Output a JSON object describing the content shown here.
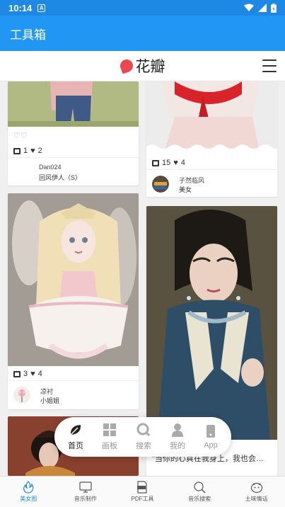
{
  "status_bar": {
    "time": "10:14",
    "notif_letter": "A"
  },
  "app_bar": {
    "title": "工具箱"
  },
  "web_header": {
    "logo_text": "花瓣"
  },
  "feed": {
    "cards": [
      {
        "likes_hearts": "♡♡",
        "repins": "1",
        "likes": "2",
        "user": "Dan024",
        "board": "回风伊人（S）"
      },
      {
        "repins": "15",
        "likes": "4",
        "user": "子然临风",
        "board": "美女"
      },
      {
        "repins": "3",
        "likes": "4",
        "user": "凉衬",
        "board": "小姐姐"
      },
      {
        "caption": "\"当你的心真在我身上，我也会…"
      }
    ]
  },
  "float_nav": {
    "items": [
      {
        "label": "首页",
        "icon": "home-leaf-icon",
        "active": true
      },
      {
        "label": "画板",
        "icon": "board-grid-icon",
        "active": false
      },
      {
        "label": "搜索",
        "icon": "search-icon",
        "active": false
      },
      {
        "label": "我的",
        "icon": "profile-icon",
        "active": false
      },
      {
        "label": "App",
        "icon": "phone-app-icon",
        "active": false
      }
    ]
  },
  "bottom_nav": {
    "items": [
      {
        "label": "美女图",
        "icon": "flame-icon",
        "active": true
      },
      {
        "label": "音乐制作",
        "icon": "monitor-icon",
        "active": false
      },
      {
        "label": "PDF工具",
        "icon": "pdf-icon",
        "active": false
      },
      {
        "label": "音乐搜索",
        "icon": "search-icon",
        "active": false
      },
      {
        "label": "土味情话",
        "icon": "face-icon",
        "active": false
      }
    ]
  },
  "colors": {
    "primary": "#2196f3",
    "status": "#1e88e5",
    "logo_petal": "#e8484f"
  }
}
